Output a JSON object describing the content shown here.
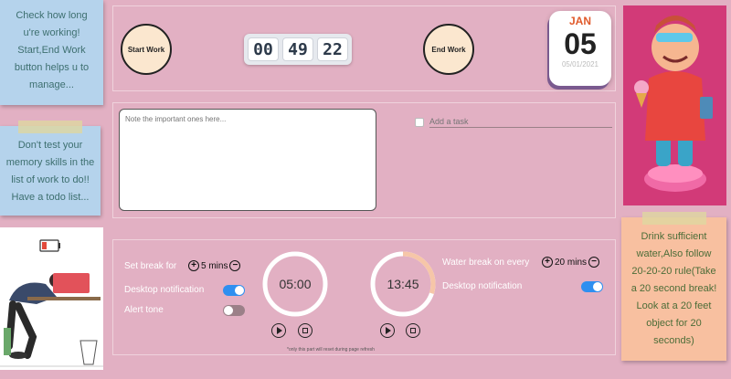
{
  "notes_left": {
    "top": [
      "Check how long",
      "u're working!",
      "Start,End Work",
      "button helps u to",
      "manage..."
    ],
    "middle": [
      "Don't test your",
      "memory skills in the",
      "list of work to do!!",
      "Have a todo list..."
    ]
  },
  "note_right": [
    "Drink sufficient",
    "water,Also follow",
    "20-20-20 rule(Take",
    "a 20 second break!",
    "Look at a 20 feet",
    "object for 20",
    "seconds)"
  ],
  "work": {
    "start_label": "Start Work",
    "end_label": "End Work",
    "timer": {
      "hours": "00",
      "minutes": "49",
      "seconds": "22"
    }
  },
  "calendar": {
    "month": "JAN",
    "day": "05",
    "date": "05/01/2021"
  },
  "notes_area": {
    "placeholder": "Note the important ones here..."
  },
  "todo": {
    "placeholder": "Add a task"
  },
  "breaks": {
    "set_break_label": "Set break for",
    "break_value": "5 mins",
    "desktop_notification_label": "Desktop notification",
    "alert_tone_label": "Alert tone",
    "desktop_notification_on": true,
    "alert_tone_on": false,
    "break_timer": "05:00",
    "water_label": "Water break on every",
    "water_value": "20 mins",
    "water_desktop_notification_label": "Desktop notification",
    "water_desktop_notification_on": true,
    "water_timer": "13:45",
    "water_progress": 0.3,
    "footnote": "*only this part will reset during page refresh"
  },
  "colors": {
    "background": "#e2b0c3",
    "accent_blue": "#2f8ff0",
    "ring_track": "#ffffff",
    "ring_progress": "#f6c6a8"
  }
}
